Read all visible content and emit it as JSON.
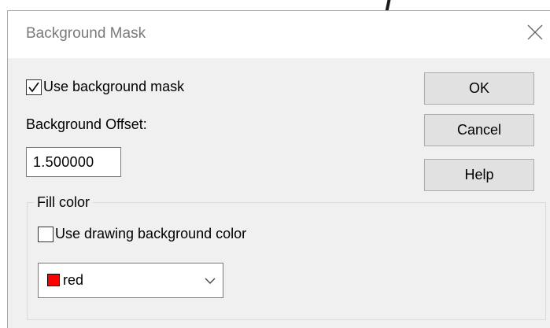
{
  "dialog": {
    "title": "Background Mask"
  },
  "mask": {
    "use_mask_label": "Use background mask",
    "use_mask_checked": true,
    "offset_label": "Background Offset:",
    "offset_value": "1.500000"
  },
  "fill": {
    "group_label": "Fill color",
    "use_drawing_bg_label": "Use drawing background color",
    "use_drawing_bg_checked": false,
    "selected_color_label": "red",
    "selected_color_hex": "#ff0000"
  },
  "buttons": {
    "ok": "OK",
    "cancel": "Cancel",
    "help": "Help"
  }
}
